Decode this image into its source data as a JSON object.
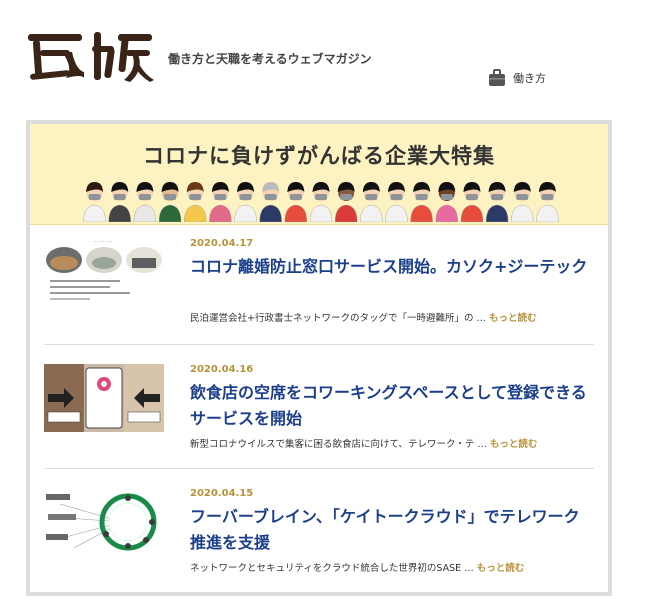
{
  "site": {
    "logo_text": "瓦版",
    "tagline": "働き方と天職を考えるウェブマガジン",
    "nav": {
      "label": "働き方",
      "icon": "briefcase-icon"
    }
  },
  "banner": {
    "title": "コロナに負けずがんばる企業大特集"
  },
  "articles": [
    {
      "date": "2020.04.17",
      "title": "コロナ離婚防止窓口サービス開始。カソク+ジーテック",
      "excerpt": "民泊運営会社+行政書士ネットワークのタッグで「一時避難所」の … ",
      "more": "もっと読む"
    },
    {
      "date": "2020.04.16",
      "title": "飲食店の空席をコワーキングスペースとして登録できるサービスを開始",
      "excerpt": "新型コロナウイルスで集客に困る飲食店に向けて、テレワーク・テ … ",
      "more": "もっと読む"
    },
    {
      "date": "2020.04.15",
      "title": "フーバーブレイン、「ケイトークラウド」でテレワーク推進を支援",
      "excerpt": "ネットワークとセキュリティをクラウド統合した世界初のSASE … ",
      "more": "もっと読む"
    }
  ],
  "colors": {
    "banner_bg": "#fdf3c2",
    "date": "#b8923a",
    "title": "#1c3f8c",
    "logo": "#3a2418"
  }
}
